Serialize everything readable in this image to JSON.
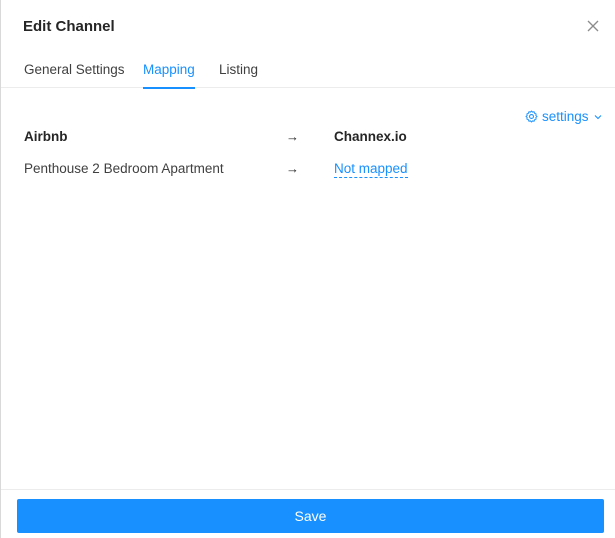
{
  "modal": {
    "title": "Edit Channel",
    "close_icon": "close-icon"
  },
  "tabs": [
    {
      "label": "General Settings",
      "active": false
    },
    {
      "label": "Mapping",
      "active": true
    },
    {
      "label": "Listing",
      "active": false
    }
  ],
  "settings": {
    "label": "settings",
    "icon": "gear-icon",
    "caret_icon": "chevron-down-icon"
  },
  "mapping": {
    "headers": {
      "source": "Airbnb",
      "arrow": "→",
      "target": "Channex.io"
    },
    "rows": [
      {
        "source": "Penthouse 2 Bedroom Apartment",
        "arrow": "→",
        "target": "Not mapped"
      }
    ]
  },
  "footer": {
    "save_label": "Save"
  },
  "colors": {
    "accent": "#1890ff",
    "text": "#262626",
    "border": "#ececec"
  }
}
